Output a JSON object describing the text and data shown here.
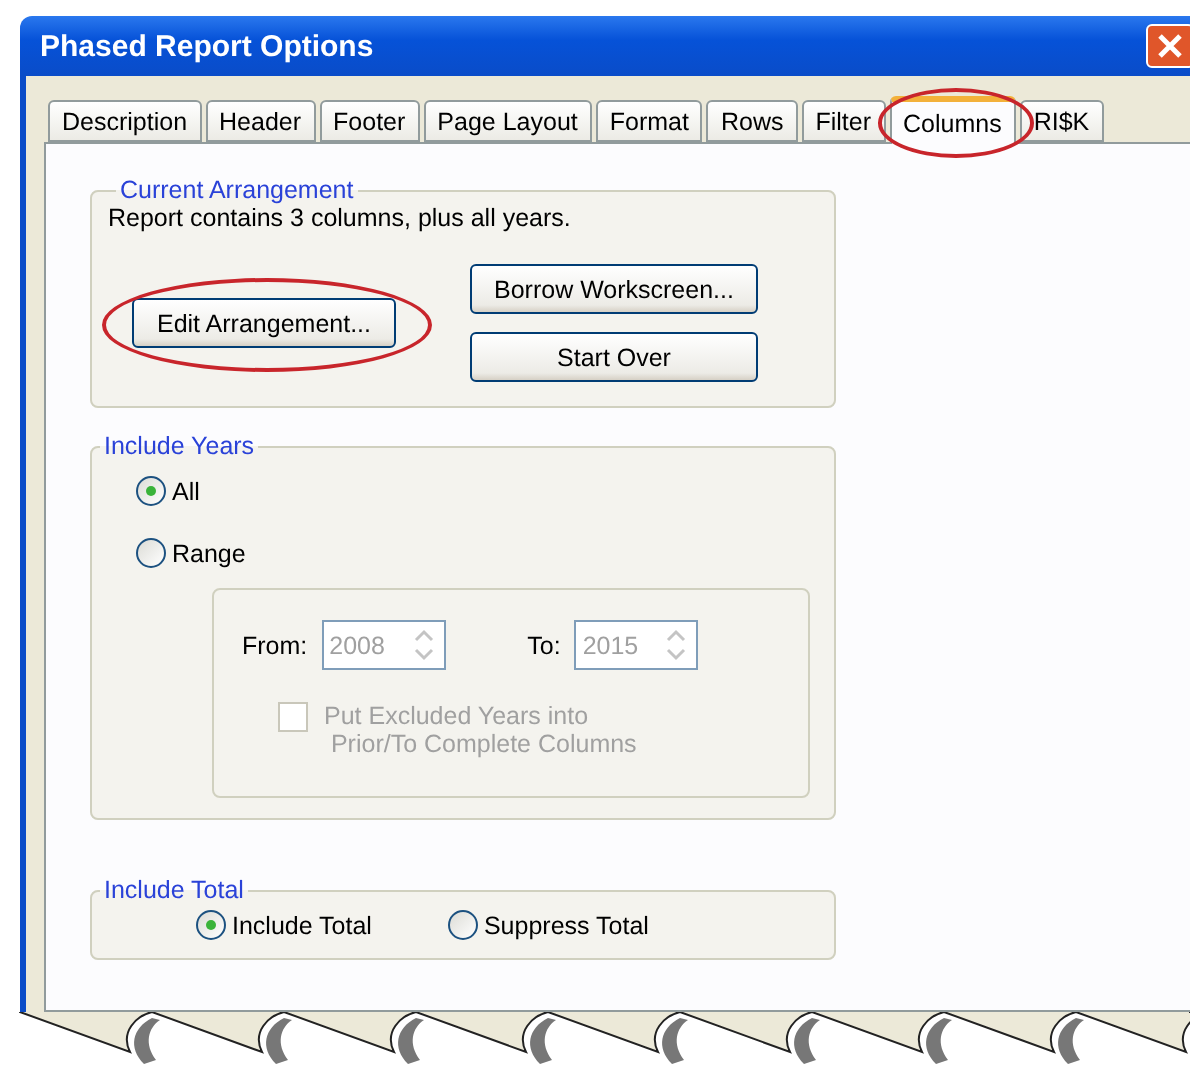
{
  "window": {
    "title": "Phased Report Options"
  },
  "tabs": [
    {
      "label": "Description",
      "selected": false,
      "highlighted": false
    },
    {
      "label": "Header",
      "selected": false,
      "highlighted": false
    },
    {
      "label": "Footer",
      "selected": false,
      "highlighted": false
    },
    {
      "label": "Page Layout",
      "selected": false,
      "highlighted": false
    },
    {
      "label": "Format",
      "selected": false,
      "highlighted": false
    },
    {
      "label": "Rows",
      "selected": false,
      "highlighted": false
    },
    {
      "label": "Filter",
      "selected": false,
      "highlighted": false
    },
    {
      "label": "Columns",
      "selected": true,
      "highlighted": true
    },
    {
      "label": "RI$K",
      "selected": false,
      "highlighted": false
    }
  ],
  "current_arrangement": {
    "title": "Current  Arrangement",
    "summary": "Report contains 3 columns, plus all years.",
    "buttons": [
      {
        "label": "Edit Arrangement...",
        "highlighted": true
      },
      {
        "label": "Borrow Workscreen...",
        "highlighted": false
      },
      {
        "label": "Start Over",
        "highlighted": false
      }
    ]
  },
  "include_years": {
    "title": "Include Years",
    "options": [
      {
        "label": "All",
        "selected": true
      },
      {
        "label": "Range",
        "selected": false
      }
    ],
    "range": {
      "disabled": true,
      "from_label": "From:",
      "from_value": "2008",
      "to_label": "To:",
      "to_value": "2015",
      "checkbox": {
        "label": "Put Excluded Years into\n Prior/To Complete Columns",
        "checked": false
      }
    }
  },
  "include_total": {
    "title": "Include Total",
    "options": [
      {
        "label": "Include Total",
        "selected": true
      },
      {
        "label": "Suppress Total",
        "selected": false
      }
    ]
  }
}
